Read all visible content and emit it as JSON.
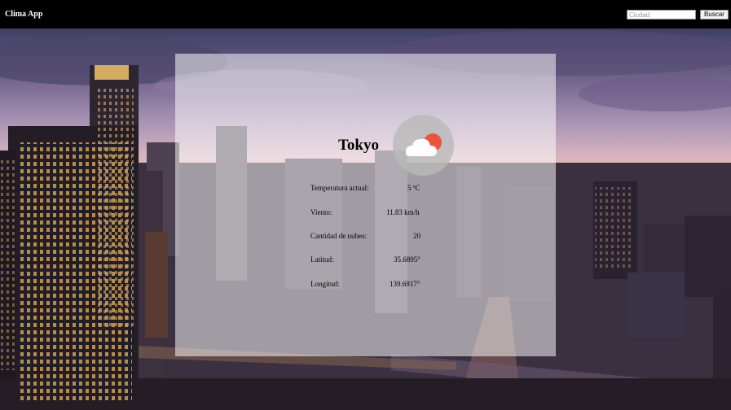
{
  "header": {
    "title": "Clima App",
    "search": {
      "placeholder": "Ciudad",
      "value": ""
    },
    "search_button_label": "Buscar"
  },
  "weather": {
    "city": "Tokyo",
    "icon": "partly-cloudy-icon",
    "rows": [
      {
        "label": "Temperatura actual:",
        "value": "5 ºC"
      },
      {
        "label": "Viento:",
        "value": "11.83 km/h"
      },
      {
        "label": "Cantidad de nubes:",
        "value": "20"
      },
      {
        "label": "Latitud:",
        "value": "35.6895°"
      },
      {
        "label": "Longitud:",
        "value": "139.6917°"
      }
    ]
  },
  "colors": {
    "header_bg": "#000000",
    "card_bg": "rgba(255,255,255,0.52)",
    "sun": "#e8553a",
    "cloud": "#ffffff"
  }
}
